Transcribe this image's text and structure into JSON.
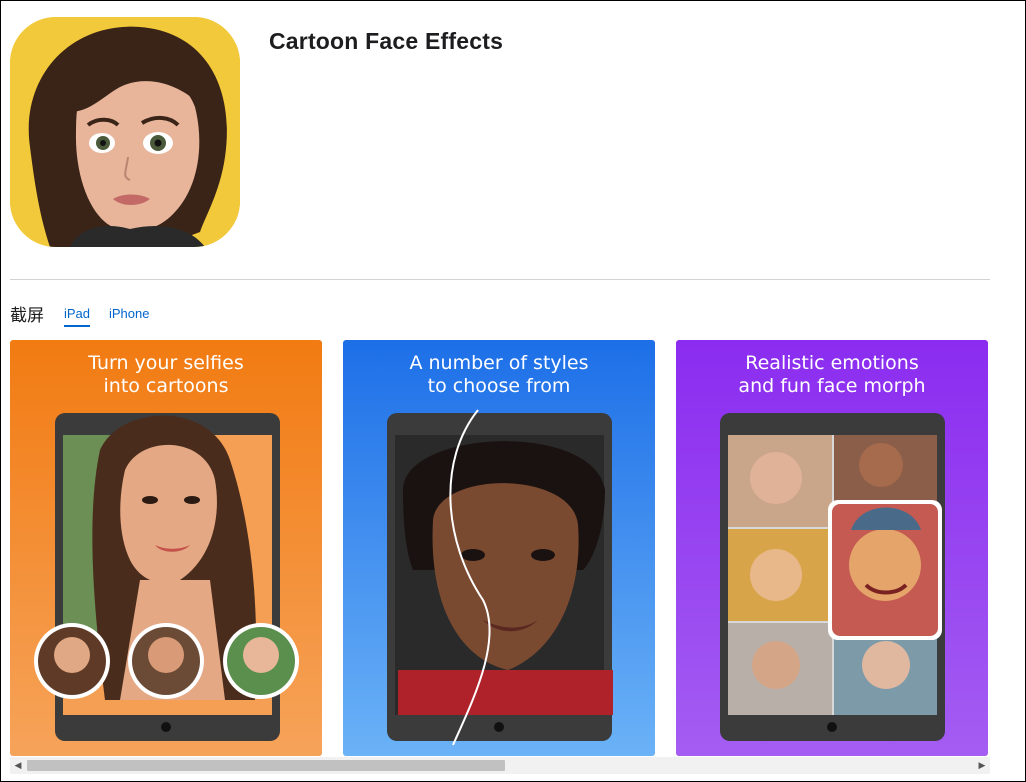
{
  "app": {
    "title": "Cartoon Face Effects",
    "icon_name": "cartoon-girl-app-icon"
  },
  "screenshots_section": {
    "label": "截屏",
    "tabs": [
      {
        "label": "iPad",
        "active": true
      },
      {
        "label": "iPhone",
        "active": false
      }
    ],
    "items": [
      {
        "caption": "Turn your selfies\ninto cartoons",
        "bg_top": "#f27b12",
        "bg_bottom": "#f6a35a"
      },
      {
        "caption": "A number of styles\nto choose from",
        "bg_top": "#1d6fe8",
        "bg_bottom": "#6bb2f7"
      },
      {
        "caption": "Realistic emotions\nand fun face morph",
        "bg_top": "#8b2cf0",
        "bg_bottom": "#a45df2"
      }
    ]
  },
  "colors": {
    "link": "#0066cc",
    "divider": "#d2d2d7"
  }
}
